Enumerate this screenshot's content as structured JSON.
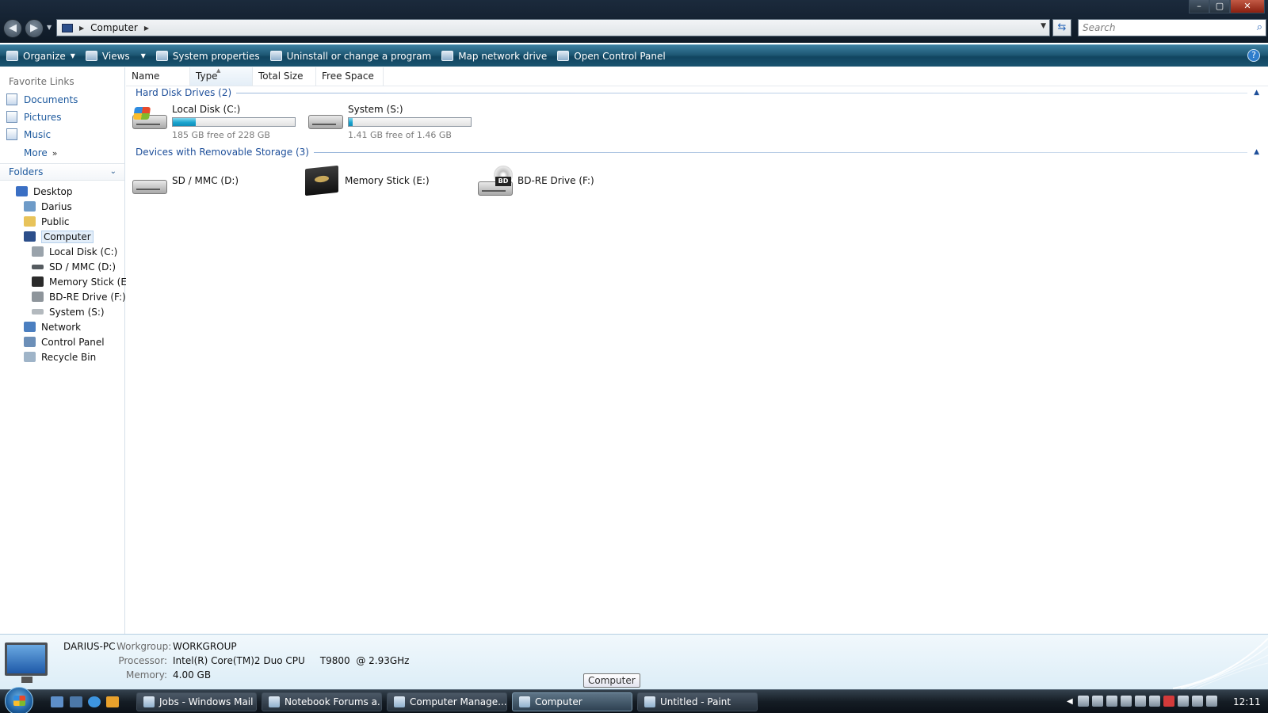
{
  "window": {
    "address_crumb": "Computer",
    "search_placeholder": "Search",
    "controls": {
      "minimize": "–",
      "maximize": "▢",
      "close": "✕"
    }
  },
  "toolbar": {
    "organize": "Organize",
    "views": "Views",
    "system_properties": "System properties",
    "uninstall": "Uninstall or change a program",
    "map_drive": "Map network drive",
    "control_panel": "Open Control Panel",
    "help": "?"
  },
  "navpane": {
    "favorites_title": "Favorite Links",
    "favorites": [
      "Documents",
      "Pictures",
      "Music"
    ],
    "more": "More",
    "folders_title": "Folders",
    "tree": [
      {
        "label": "Desktop",
        "icon": "desktop-icon",
        "color": "#3a6fc4"
      },
      {
        "label": "Darius",
        "icon": "user-folder-icon",
        "color": "#6e9bc8"
      },
      {
        "label": "Public",
        "icon": "folder-icon",
        "color": "#e8c35a"
      },
      {
        "label": "Computer",
        "icon": "computer-icon",
        "color": "#2c4e8a"
      },
      {
        "label": "Local Disk (C:)",
        "icon": "hdd-icon",
        "color": "#9aa3ab"
      },
      {
        "label": "SD / MMC (D:)",
        "icon": "removable-drive-icon",
        "color": "#555b60"
      },
      {
        "label": "Memory Stick (E:)",
        "icon": "memory-stick-icon",
        "color": "#2b2b2b"
      },
      {
        "label": "BD-RE Drive (F:)",
        "icon": "bd-drive-icon",
        "color": "#8e959b"
      },
      {
        "label": "System (S:)",
        "icon": "hdd-icon",
        "color": "#b3b9be"
      },
      {
        "label": "Network",
        "icon": "network-icon",
        "color": "#4b7fc0"
      },
      {
        "label": "Control Panel",
        "icon": "control-panel-icon",
        "color": "#6c8fb8"
      },
      {
        "label": "Recycle Bin",
        "icon": "recycle-bin-icon",
        "color": "#9fb4c8"
      }
    ]
  },
  "columns": [
    "Name",
    "Type",
    "Total Size",
    "Free Space"
  ],
  "groups": {
    "hdd_title": "Hard Disk Drives (2)",
    "removable_title": "Devices with Removable Storage (3)"
  },
  "drives": {
    "c": {
      "name": "Local Disk (C:)",
      "free": "185 GB free of 228 GB",
      "used_fraction": 0.19
    },
    "s": {
      "name": "System (S:)",
      "free": "1.41 GB free of 1.46 GB",
      "used_fraction": 0.03
    },
    "d": {
      "name": "SD / MMC (D:)"
    },
    "e": {
      "name": "Memory Stick (E:)"
    },
    "f": {
      "name": "BD-RE Drive (F:)",
      "badge": "BD"
    }
  },
  "details": {
    "computer_name": "DARIUS-PC",
    "workgroup_label": "Workgroup:",
    "workgroup": "WORKGROUP",
    "processor_label": "Processor:",
    "processor": "Intel(R) Core(TM)2 Duo CPU     T9800  @ 2.93GHz",
    "memory_label": "Memory:",
    "memory": "4.00 GB"
  },
  "tooltip": "Computer",
  "taskbar": {
    "buttons": [
      {
        "label": "Jobs - Windows Mail"
      },
      {
        "label": "Notebook Forums a..."
      },
      {
        "label": "Computer Manage..."
      },
      {
        "label": "Computer",
        "active": true
      },
      {
        "label": "Untitled - Paint"
      }
    ],
    "clock": "12:11"
  }
}
